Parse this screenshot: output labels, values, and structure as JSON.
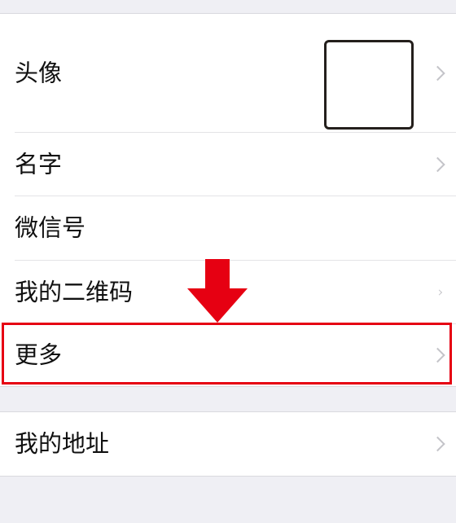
{
  "profile": {
    "rows": [
      {
        "label": "头像"
      },
      {
        "label": "名字"
      },
      {
        "label": "微信号"
      },
      {
        "label": "我的二维码"
      },
      {
        "label": "更多"
      }
    ],
    "address": {
      "label": "我的地址"
    }
  },
  "colors": {
    "highlight": "#e60012",
    "background": "#efeff4",
    "cell": "#ffffff"
  }
}
